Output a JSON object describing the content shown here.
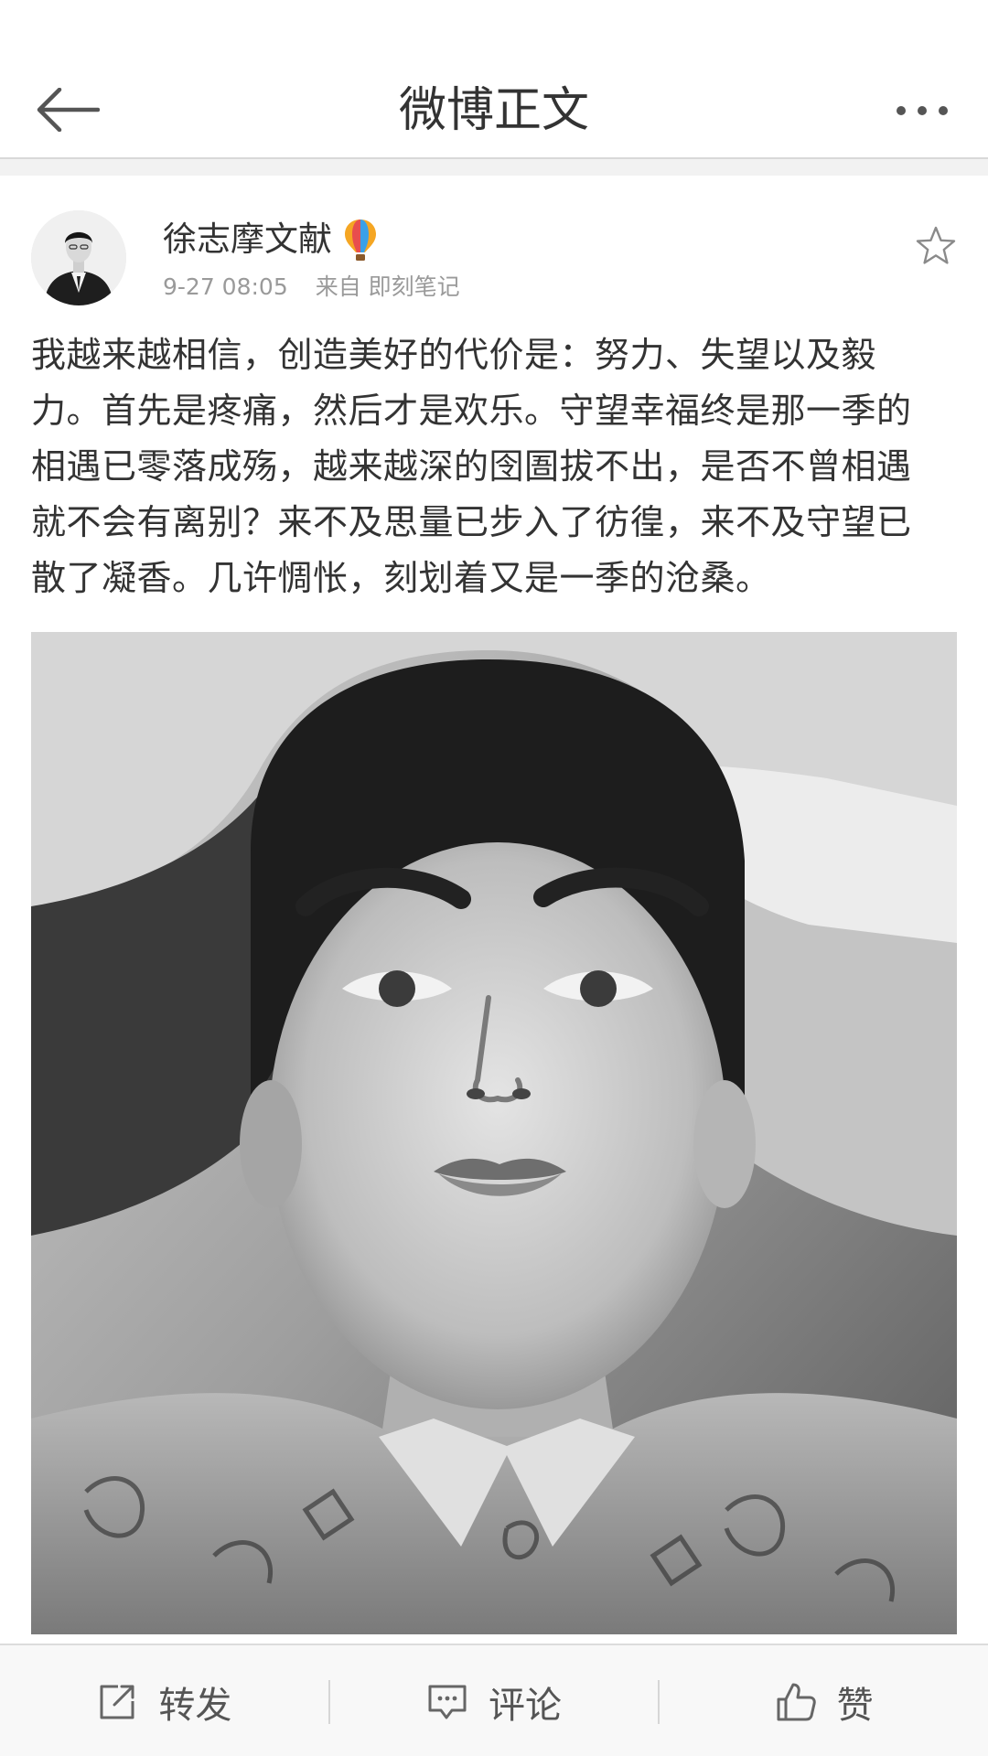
{
  "nav": {
    "title": "微博正文",
    "back_icon": "arrow-left-icon",
    "more_icon": "more-dots-icon"
  },
  "post": {
    "author": "徐志摩文献",
    "author_badge_icon": "hot-air-balloon-icon",
    "time": "9-27 08:05",
    "source": "来自 即刻笔记",
    "favorite_icon": "star-outline-icon",
    "lines": [
      "我越来越相信，创造美好的代价是：努力、失望以及毅",
      "力。首先是疼痛，然后才是欢乐。守望幸福终是那一季的",
      "相遇已零落成殇，越来越深的囹圄拔不出，是否不曾相遇",
      "就不会有离别？来不及思量已步入了彷徨，来不及守望已",
      "散了凝香。几许惆怅，刻划着又是一季的沧桑。"
    ],
    "image_description_icon": "photo-image"
  },
  "toolbar": {
    "repost_label": "转发",
    "comment_label": "评论",
    "like_label": "赞"
  },
  "colors": {
    "text": "#333333",
    "meta": "#9a9a9a",
    "divider": "#d8d8d8",
    "toolbar_bg": "#f8f8f8"
  }
}
